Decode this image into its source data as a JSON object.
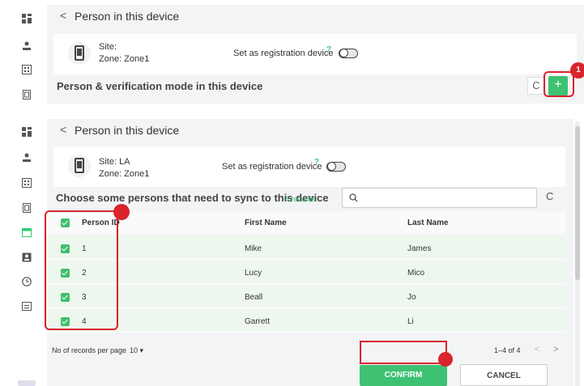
{
  "top": {
    "title": "Person in this device",
    "site_label": "Site:",
    "zone_label": "Zone: Zone1",
    "reg_label": "Set as registration device",
    "help": "?",
    "section_title": "Person & verification mode in this device",
    "add_symbol": "+",
    "refresh_symbol": "C",
    "badge": "1"
  },
  "bottom": {
    "title": "Person in this device",
    "site_label": "Site: LA",
    "zone_label": "Zone: Zone1",
    "reg_label": "Set as registration device",
    "help": "?",
    "choose_title": "Choose some persons that need to sync to this device",
    "records_count": "-4 records",
    "search_placeholder": "",
    "refresh_symbol": "C",
    "columns": [
      "Person ID",
      "First Name",
      "Last Name"
    ],
    "rows": [
      {
        "id": "1",
        "first": "Mike",
        "last": "James"
      },
      {
        "id": "2",
        "first": "Lucy",
        "last": "Mico"
      },
      {
        "id": "3",
        "first": "Beall",
        "last": "Jo"
      },
      {
        "id": "4",
        "first": "Garrett",
        "last": "Li"
      }
    ],
    "per_page_label": "No of records per page",
    "per_page_value": "10",
    "pagination": "1–4 of 4",
    "confirm": "CONFIRM",
    "cancel": "CANCEL"
  },
  "colors": {
    "accent": "#3ec173",
    "highlight": "#d9232d",
    "row_bg": "#eef7ee"
  }
}
